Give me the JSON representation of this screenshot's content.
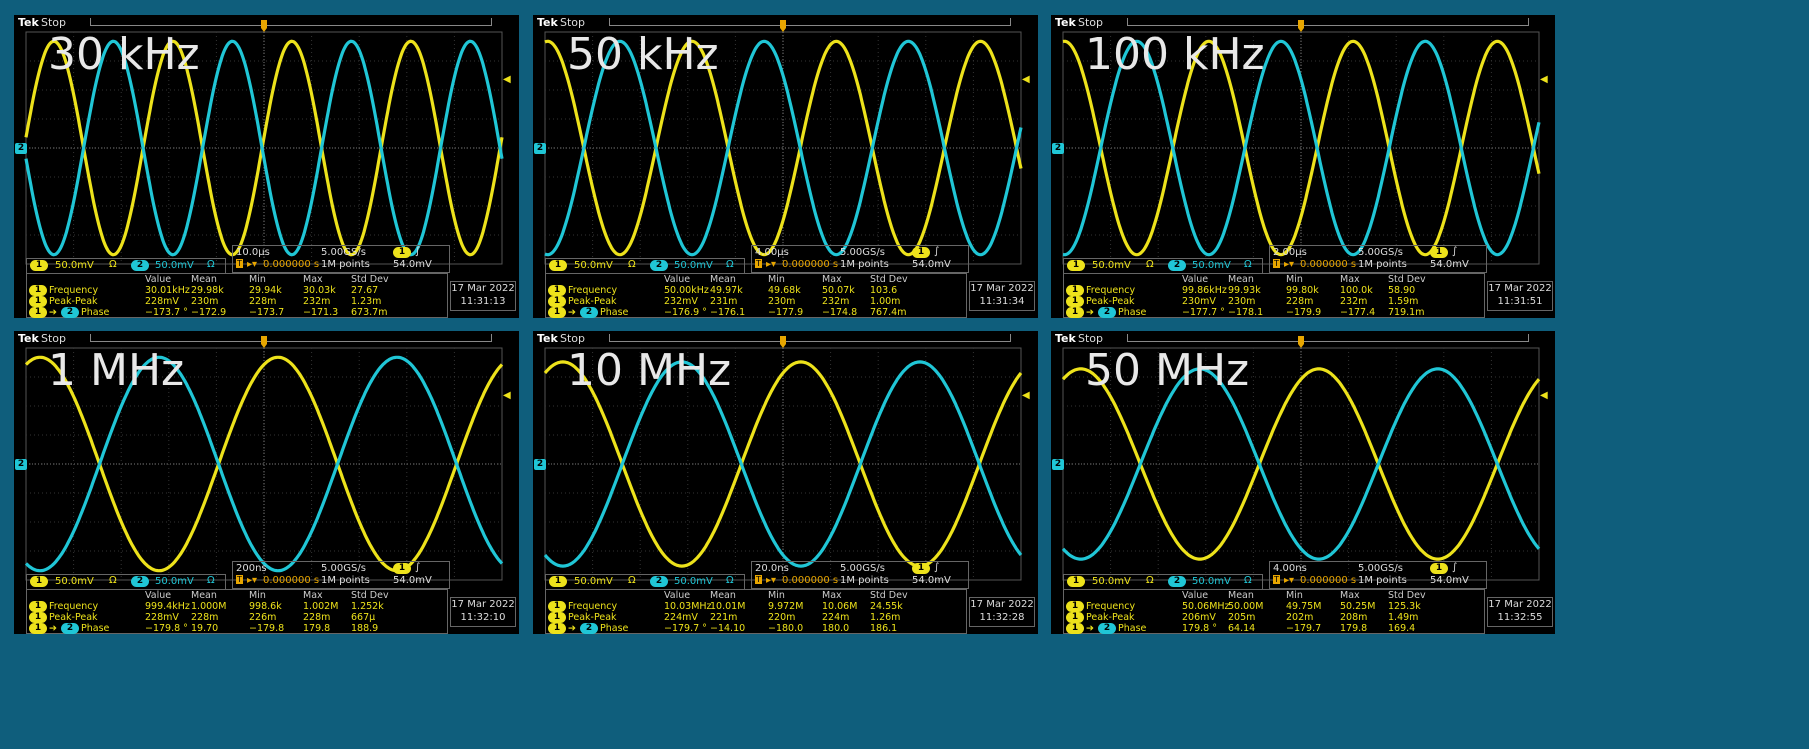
{
  "colors": {
    "ch1": "#ede21b",
    "ch2": "#20c6d6",
    "trigger": "#e8a600"
  },
  "panels": [
    {
      "label": "30 kHz",
      "brand": "Tek",
      "status": "Stop",
      "ch1_scale": "50.0mV",
      "ch2_scale": "50.0mV",
      "timebase": "10.0µs",
      "sample_rate": "5.00GS/s",
      "trig_delay": "0.000000 s",
      "record": "1M points",
      "trig_level": "54.0mV",
      "date": "17 Mar  2022",
      "time": "11:31:13",
      "headers": [
        "Value",
        "Mean",
        "Min",
        "Max",
        "Std Dev"
      ],
      "meas": [
        {
          "name": "Frequency",
          "ch": "1",
          "values": [
            "30.01kHz",
            "29.98k",
            "29.94k",
            "30.03k",
            "27.67"
          ]
        },
        {
          "name": "Peak-Peak",
          "ch": "1",
          "values": [
            "228mV",
            "230m",
            "228m",
            "232m",
            "1.23m"
          ]
        },
        {
          "name": "Phase",
          "ch": "1→2",
          "values": [
            "−173.7 °",
            "−172.9",
            "−173.7",
            "−171.3",
            "673.7m"
          ]
        }
      ],
      "cycles": 4.0,
      "phase": 0.1,
      "amp": 0.92
    },
    {
      "label": "50 kHz",
      "brand": "Tek",
      "status": "Stop",
      "ch1_scale": "50.0mV",
      "ch2_scale": "50.0mV",
      "timebase": "4.00µs",
      "sample_rate": "5.00GS/s",
      "trig_delay": "0.000000 s",
      "record": "1M points",
      "trig_level": "54.0mV",
      "date": "17 Mar  2022",
      "time": "11:31:34",
      "headers": [
        "Value",
        "Mean",
        "Min",
        "Max",
        "Std Dev"
      ],
      "meas": [
        {
          "name": "Frequency",
          "ch": "1",
          "values": [
            "50.00kHz",
            "49.97k",
            "49.68k",
            "50.07k",
            "103.6"
          ]
        },
        {
          "name": "Peak-Peak",
          "ch": "1",
          "values": [
            "232mV",
            "231m",
            "230m",
            "232m",
            "1.00m"
          ]
        },
        {
          "name": "Phase",
          "ch": "1→2",
          "values": [
            "−176.9 °",
            "−176.1",
            "−177.9",
            "−174.8",
            "767.4m"
          ]
        }
      ],
      "cycles": 3.3,
      "phase": 1.45,
      "amp": 0.92
    },
    {
      "label": "100 kHz",
      "brand": "Tek",
      "status": "Stop",
      "ch1_scale": "50.0mV",
      "ch2_scale": "50.0mV",
      "timebase": "2.00µs",
      "sample_rate": "5.00GS/s",
      "trig_delay": "0.000000 s",
      "record": "1M points",
      "trig_level": "54.0mV",
      "date": "17 Mar  2022",
      "time": "11:31:51",
      "headers": [
        "Value",
        "Mean",
        "Min",
        "Max",
        "Std Dev"
      ],
      "meas": [
        {
          "name": "Frequency",
          "ch": "1",
          "values": [
            "99.86kHz",
            "99.93k",
            "99.80k",
            "100.0k",
            "58.90"
          ]
        },
        {
          "name": "Peak-Peak",
          "ch": "1",
          "values": [
            "230mV",
            "230m",
            "228m",
            "232m",
            "1.59m"
          ]
        },
        {
          "name": "Phase",
          "ch": "1→2",
          "values": [
            "−177.7 °",
            "−178.1",
            "−179.9",
            "−177.4",
            "719.1m"
          ]
        }
      ],
      "cycles": 3.3,
      "phase": 1.5,
      "amp": 0.92
    },
    {
      "label": "1 MHz",
      "brand": "Tek",
      "status": "Stop",
      "ch1_scale": "50.0mV",
      "ch2_scale": "50.0mV",
      "timebase": "200ns",
      "sample_rate": "5.00GS/s",
      "trig_delay": "0.000000 s",
      "record": "1M points",
      "trig_level": "54.0mV",
      "date": "17 Mar  2022",
      "time": "11:32:10",
      "headers": [
        "Value",
        "Mean",
        "Min",
        "Max",
        "Std Dev"
      ],
      "meas": [
        {
          "name": "Frequency",
          "ch": "1",
          "values": [
            "999.4kHz",
            "1.000M",
            "998.6k",
            "1.002M",
            "1.252k"
          ]
        },
        {
          "name": "Peak-Peak",
          "ch": "1",
          "values": [
            "228mV",
            "228m",
            "226m",
            "228m",
            "667µ"
          ]
        },
        {
          "name": "Phase",
          "ch": "1→2",
          "values": [
            "−179.8 °",
            "19.70",
            "−179.8",
            "179.8",
            "188.9"
          ]
        }
      ],
      "cycles": 2.0,
      "phase": 1.2,
      "amp": 0.92
    },
    {
      "label": "10 MHz",
      "brand": "Tek",
      "status": "Stop",
      "ch1_scale": "50.0mV",
      "ch2_scale": "50.0mV",
      "timebase": "20.0ns",
      "sample_rate": "5.00GS/s",
      "trig_delay": "0.000000 s",
      "record": "1M points",
      "trig_level": "54.0mV",
      "date": "17 Mar  2022",
      "time": "11:32:28",
      "headers": [
        "Value",
        "Mean",
        "Min",
        "Max",
        "Std Dev"
      ],
      "meas": [
        {
          "name": "Frequency",
          "ch": "1",
          "values": [
            "10.03MHz",
            "10.01M",
            "9.972M",
            "10.06M",
            "24.55k"
          ]
        },
        {
          "name": "Peak-Peak",
          "ch": "1",
          "values": [
            "224mV",
            "221m",
            "220m",
            "224m",
            "1.26m"
          ]
        },
        {
          "name": "Phase",
          "ch": "1→2",
          "values": [
            "−179.7 °",
            "−14.10",
            "−180.0",
            "180.0",
            "186.1"
          ]
        }
      ],
      "cycles": 2.0,
      "phase": 1.1,
      "amp": 0.88
    },
    {
      "label": "50 MHz",
      "brand": "Tek",
      "status": "Stop",
      "ch1_scale": "50.0mV",
      "ch2_scale": "50.0mV",
      "timebase": "4.00ns",
      "sample_rate": "5.00GS/s",
      "trig_delay": "0.000000 s",
      "record": "1M points",
      "trig_level": "54.0mV",
      "date": "17 Mar  2022",
      "time": "11:32:55",
      "headers": [
        "Value",
        "Mean",
        "Min",
        "Max",
        "Std Dev"
      ],
      "meas": [
        {
          "name": "Frequency",
          "ch": "1",
          "values": [
            "50.06MHz",
            "50.00M",
            "49.75M",
            "50.25M",
            "125.3k"
          ]
        },
        {
          "name": "Peak-Peak",
          "ch": "1",
          "values": [
            "206mV",
            "205m",
            "202m",
            "208m",
            "1.49m"
          ]
        },
        {
          "name": "Phase",
          "ch": "1→2",
          "values": [
            "179.8 °",
            "64.14",
            "−179.7",
            "179.8",
            "169.4"
          ]
        }
      ],
      "cycles": 2.0,
      "phase": 1.1,
      "amp": 0.82
    }
  ]
}
